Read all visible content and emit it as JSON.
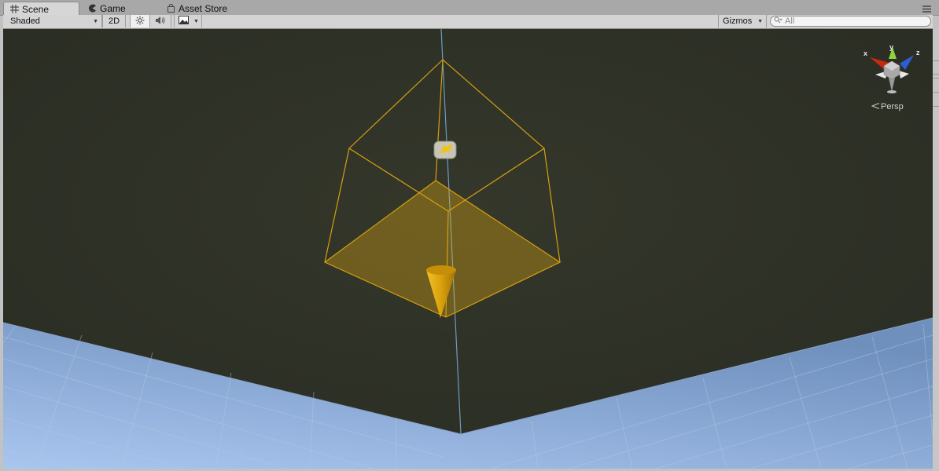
{
  "tabs": [
    {
      "label": "Scene",
      "icon": "grid-icon"
    },
    {
      "label": "Game",
      "icon": "pacman-icon"
    },
    {
      "label": "Asset Store",
      "icon": "bag-icon"
    }
  ],
  "toolbar": {
    "shading_mode": "Shaded",
    "mode_2d": "2D",
    "gizmos_label": "Gizmos",
    "search_placeholder": "All"
  },
  "scene_gizmo": {
    "axis_x": "x",
    "axis_y": "y",
    "axis_z": "z",
    "projection": "Persp",
    "colors": {
      "x": "#c62a0e",
      "y": "#8fd43b",
      "z": "#2a5fd6"
    }
  },
  "colors": {
    "viewport_bg": "#2c2f22",
    "ground": "#7e9fcf",
    "light_gizmo": "#e6ad12",
    "cone": "#d8a30e"
  }
}
